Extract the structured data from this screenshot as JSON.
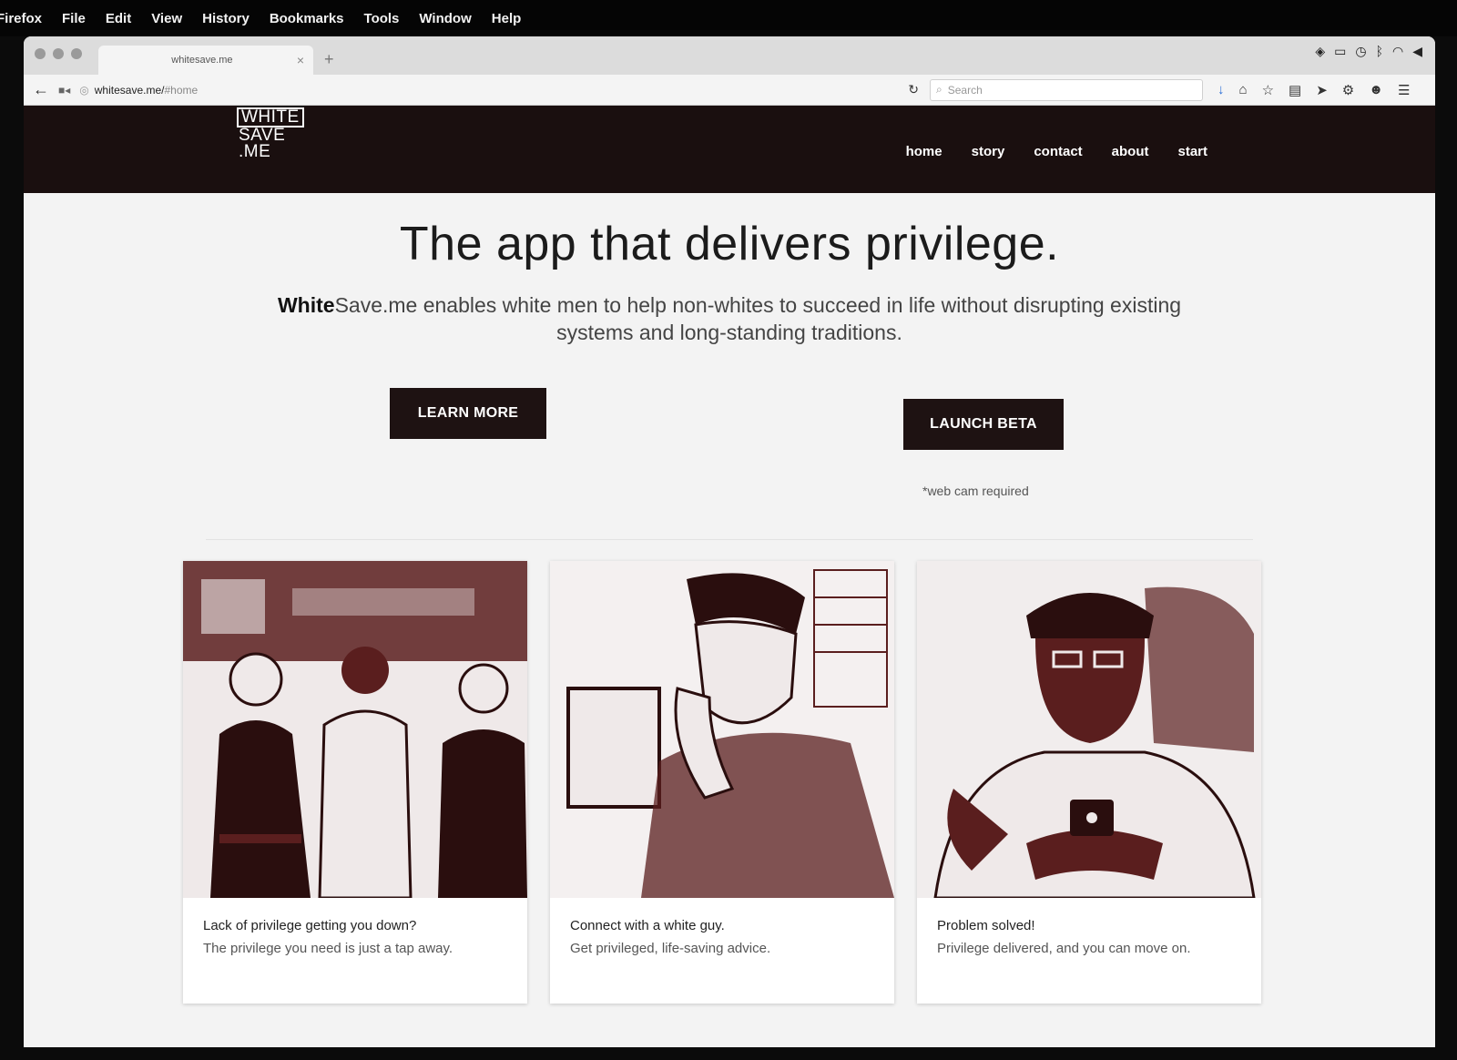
{
  "menubar": {
    "items": [
      "Firefox",
      "File",
      "Edit",
      "View",
      "History",
      "Bookmarks",
      "Tools",
      "Window",
      "Help"
    ]
  },
  "browser": {
    "tab_title": "whitesave.me",
    "url_host": "whitesave.me/",
    "url_hash": "#home",
    "search_placeholder": "Search"
  },
  "site": {
    "logo": [
      "WHITE",
      "SAVE",
      ".ME"
    ],
    "nav": [
      "home",
      "story",
      "contact",
      "about",
      "start"
    ],
    "hero_title": "The app that delivers privilege.",
    "hero_brand_bold": "White",
    "hero_brand_rest": "Save.me",
    "hero_subtitle": " enables white men to help non-whites to succeed in life without disrupting existing systems and long-standing traditions.",
    "learn_more": "LEARN MORE",
    "launch_beta": "LAUNCH BETA",
    "webcam_note": "*web cam required",
    "cards": [
      {
        "line1": "Lack of privilege getting you down?",
        "line2": "The privilege you need is just a tap away."
      },
      {
        "line1": "Connect with a white guy.",
        "line2": "Get privileged, life-saving advice."
      },
      {
        "line1": "Problem solved!",
        "line2": "Privilege delivered, and you can move on."
      }
    ]
  },
  "colors": {
    "header_bg": "#1a0f0f",
    "button_bg": "#1e1212",
    "illustration_tint": "#5a1e1e"
  }
}
